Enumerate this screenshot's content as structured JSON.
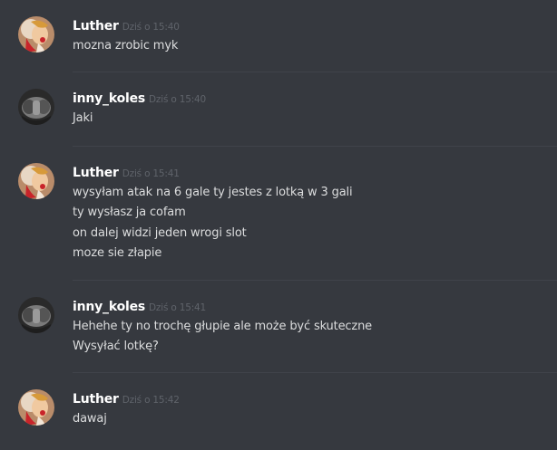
{
  "messages": [
    {
      "author": "Luther",
      "timestamp": "Dziś o 15:40",
      "avatar": "luther-avatar",
      "lines": [
        "mozna zrobic myk"
      ]
    },
    {
      "author": "inny_koles",
      "timestamp": "Dziś o 15:40",
      "avatar": "inny-koles-avatar",
      "lines": [
        "Jaki"
      ]
    },
    {
      "author": "Luther",
      "timestamp": "Dziś o 15:41",
      "avatar": "luther-avatar",
      "lines": [
        "wysyłam atak na 6 gale ty jestes z lotką w 3 gali",
        "ty wysłasz ja cofam",
        "on dalej widzi jeden wrogi slot",
        "moze sie złapie"
      ]
    },
    {
      "author": "inny_koles",
      "timestamp": "Dziś o 15:41",
      "avatar": "inny-koles-avatar",
      "lines": [
        "Hehehe ty no trochę głupie ale może być skuteczne",
        "Wysyłać lotkę?"
      ]
    },
    {
      "author": "Luther",
      "timestamp": "Dziś o 15:42",
      "avatar": "luther-avatar",
      "lines": [
        "dawaj"
      ]
    }
  ],
  "colors": {
    "background": "#36393f",
    "username": "#ffffff",
    "timestamp": "#5f636a",
    "message_text": "#dcddde",
    "divider": "#40434a"
  }
}
